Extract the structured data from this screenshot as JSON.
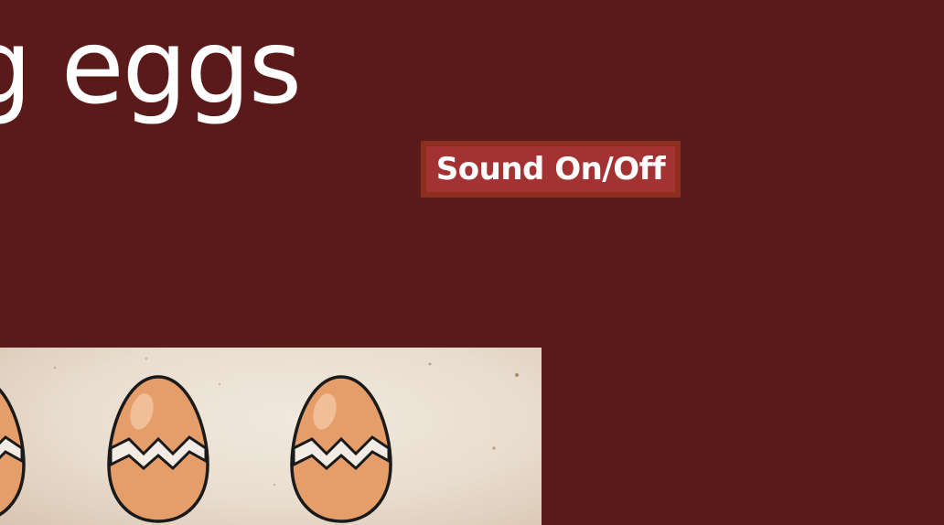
{
  "game": {
    "title": "g eggs",
    "sound_toggle_label": "Sound On/Off"
  },
  "board": {
    "eggs": [
      {
        "id": "egg-1",
        "state": "cracked",
        "icon": "cracked-egg-icon"
      },
      {
        "id": "egg-2",
        "state": "cracked",
        "icon": "cracked-egg-icon"
      },
      {
        "id": "egg-3",
        "state": "cracked",
        "icon": "cracked-egg-icon"
      }
    ]
  },
  "colors": {
    "background": "#5a1a1a",
    "button_border": "#8c2f1f",
    "button_fill": "#a33232",
    "egg_fill": "#e59d69",
    "board_paper": "#ece2d6"
  }
}
